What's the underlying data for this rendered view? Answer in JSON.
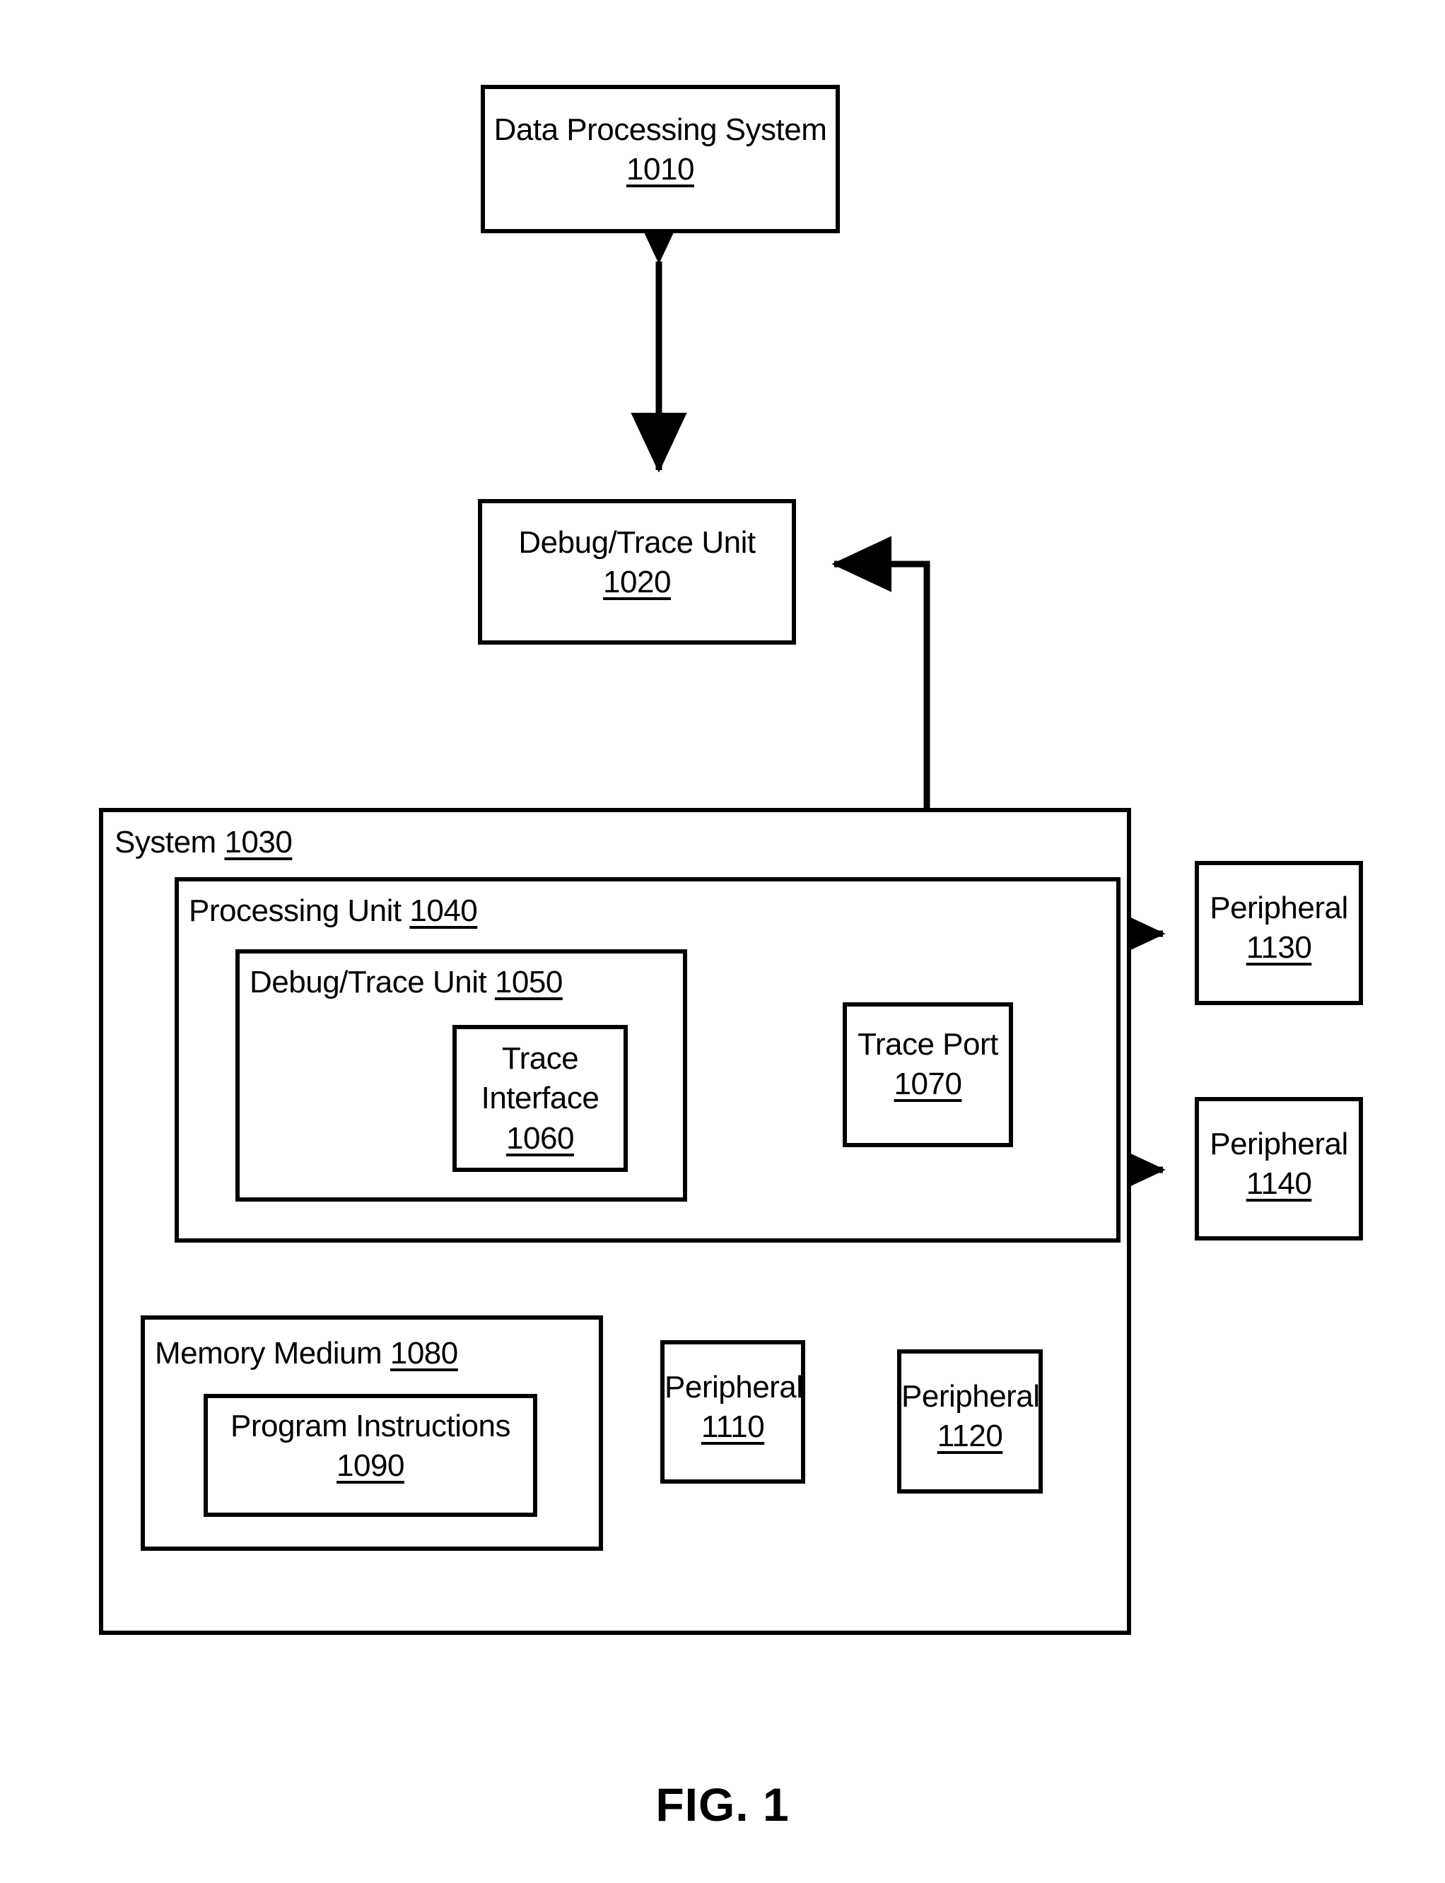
{
  "figure": {
    "caption": "FIG. 1",
    "type": "block-diagram"
  },
  "blocks": {
    "data_processing_system": {
      "name": "Data Processing System",
      "ref": "1010"
    },
    "debug_trace_unit_top": {
      "name": "Debug/Trace Unit",
      "ref": "1020"
    },
    "system": {
      "name": "System",
      "ref": "1030"
    },
    "processing_unit": {
      "name": "Processing Unit",
      "ref": "1040"
    },
    "debug_trace_unit_inner": {
      "name": "Debug/Trace Unit",
      "ref": "1050"
    },
    "trace_interface": {
      "name_line1": "Trace",
      "name_line2": "Interface",
      "ref": "1060"
    },
    "trace_port": {
      "name": "Trace Port",
      "ref": "1070"
    },
    "memory_medium": {
      "name": "Memory Medium",
      "ref": "1080"
    },
    "program_instructions": {
      "name": "Program Instructions",
      "ref": "1090"
    },
    "peripheral_1110": {
      "name": "Peripheral",
      "ref": "1110"
    },
    "peripheral_1120": {
      "name": "Peripheral",
      "ref": "1120"
    },
    "peripheral_1130": {
      "name": "Peripheral",
      "ref": "1130"
    },
    "peripheral_1140": {
      "name": "Peripheral",
      "ref": "1140"
    }
  },
  "connections": [
    {
      "id": "dps-dtu",
      "from": "data_processing_system",
      "to": "debug_trace_unit_top",
      "style": "double-arrow-vertical"
    },
    {
      "id": "traceport-dtu",
      "from": "trace_port",
      "to": "debug_trace_unit_top",
      "style": "elbow-arrow-up-left"
    },
    {
      "id": "traceiface-traceport",
      "from": "trace_interface",
      "to": "trace_port",
      "style": "double-arrow-horizontal"
    },
    {
      "id": "pu-memory",
      "from": "processing_unit",
      "to": "memory_medium",
      "style": "double-arrow-vertical"
    },
    {
      "id": "pu-per1110",
      "from": "processing_unit",
      "to": "peripheral_1110",
      "style": "double-arrow-vertical"
    },
    {
      "id": "pu-per1120",
      "from": "processing_unit",
      "to": "peripheral_1120",
      "style": "double-arrow-vertical"
    },
    {
      "id": "pu-per1130",
      "from": "processing_unit",
      "to": "peripheral_1130",
      "style": "double-arrow-horizontal"
    },
    {
      "id": "pu-per1140",
      "from": "processing_unit",
      "to": "peripheral_1140",
      "style": "double-arrow-horizontal"
    }
  ],
  "style": {
    "line_color": "#000000",
    "background": "#ffffff"
  }
}
